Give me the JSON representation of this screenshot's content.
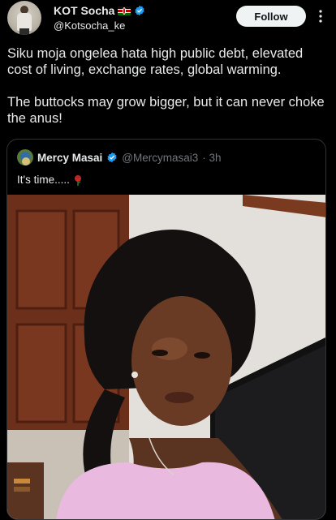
{
  "author": {
    "display_name": "KOT Socha",
    "handle": "@Kotsocha_ke",
    "flag_icon": "kenya-flag-icon",
    "verified_icon": "verified-badge-icon"
  },
  "actions": {
    "follow_label": "Follow",
    "more_icon": "more-options-icon"
  },
  "tweet": {
    "paragraphs": [
      "Siku moja ongelea hata high public debt, elevated cost of living, exchange rates, global warming.",
      "The buttocks may grow bigger, but it can never choke the anus!"
    ]
  },
  "quoted": {
    "display_name": "Mercy Masai",
    "handle": "@Mercymasai3",
    "time": "· 3h",
    "text": "It's time.....",
    "emoji_icon": "rose-icon",
    "image_icon": "selfie-photo"
  },
  "colors": {
    "background": "#000000",
    "text": "#e7e9ea",
    "muted": "#71767b",
    "verified": "#1d9bf0",
    "border": "#2f3336"
  }
}
